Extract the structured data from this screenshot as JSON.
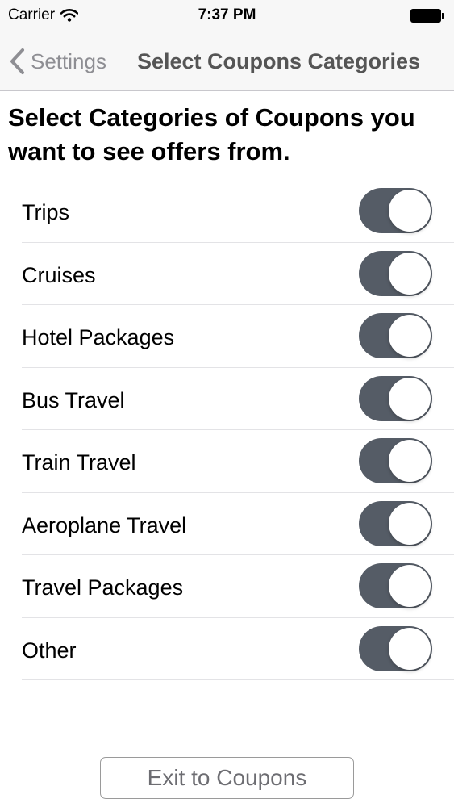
{
  "status_bar": {
    "carrier": "Carrier",
    "time": "7:37 PM",
    "wifi_icon": "wifi-icon",
    "battery_icon": "battery-icon"
  },
  "nav": {
    "back_label": "Settings",
    "back_icon": "chevron-left-icon",
    "title": "Select Coupons Categories"
  },
  "heading": "Select Categories of Coupons you want to see offers from.",
  "categories": [
    {
      "label": "Trips",
      "enabled": true
    },
    {
      "label": "Cruises",
      "enabled": true
    },
    {
      "label": "Hotel Packages",
      "enabled": true
    },
    {
      "label": "Bus Travel",
      "enabled": true
    },
    {
      "label": "Train Travel",
      "enabled": true
    },
    {
      "label": "Aeroplane Travel",
      "enabled": true
    },
    {
      "label": "Travel Packages",
      "enabled": true
    },
    {
      "label": "Other",
      "enabled": true
    }
  ],
  "exit_button": {
    "label": "Exit to Coupons"
  },
  "colors": {
    "toggle_on": "#555c66",
    "nav_background": "#f7f7f7",
    "back_text": "#8e8e93"
  }
}
